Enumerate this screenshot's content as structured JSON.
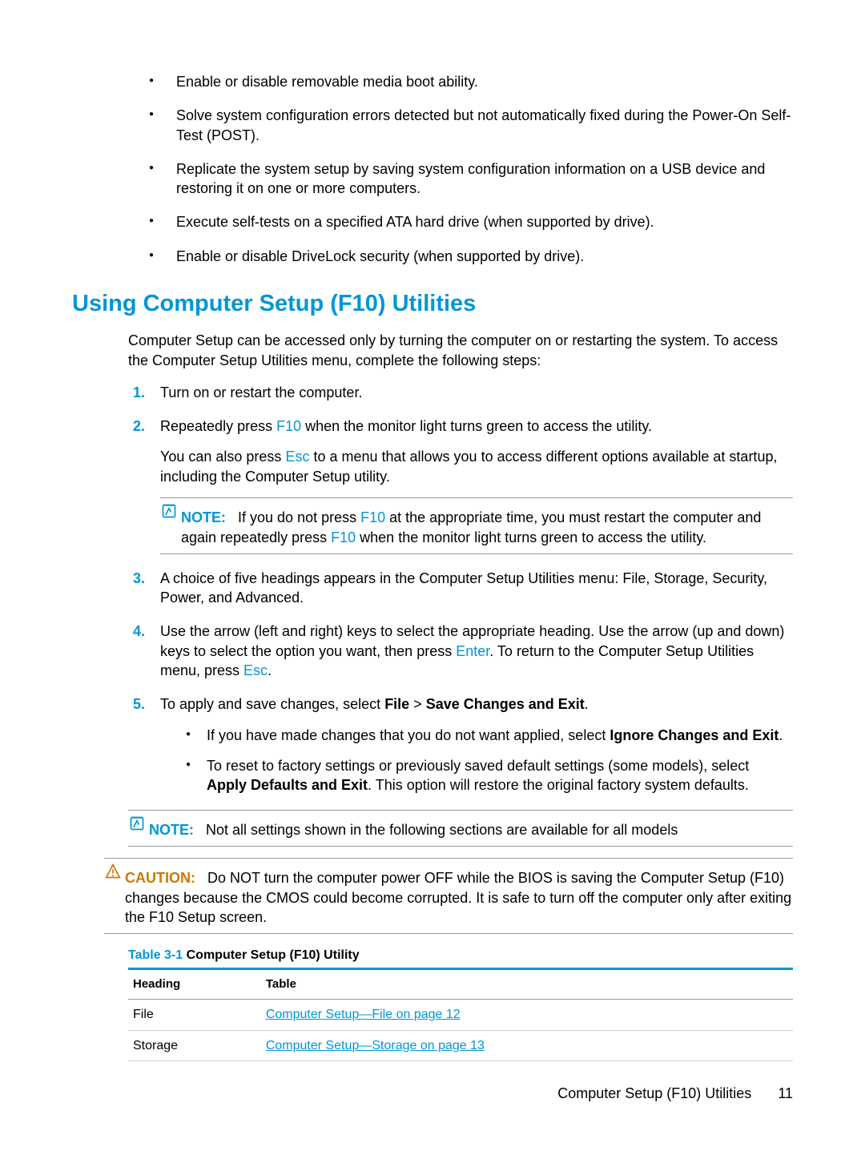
{
  "top_bullets": [
    "Enable or disable removable media boot ability.",
    "Solve system configuration errors detected but not automatically fixed during the Power-On Self-Test (POST).",
    "Replicate the system setup by saving system configuration information on a USB device and restoring it on one or more computers.",
    "Execute self-tests on a specified ATA hard drive (when supported by drive).",
    "Enable or disable DriveLock security (when supported by drive)."
  ],
  "section_title": "Using Computer Setup (F10) Utilities",
  "intro": "Computer Setup can be accessed only by turning the computer on or restarting the system. To access the Computer Setup Utilities menu, complete the following steps:",
  "keys": {
    "f10": "F10",
    "esc": "Esc",
    "enter": "Enter"
  },
  "steps": {
    "s1": "Turn on or restart the computer.",
    "s2_a": "Repeatedly press ",
    "s2_b": " when the monitor light turns green to access the utility.",
    "s2_c": "You can also press ",
    "s2_d": " to a menu that allows you to access different options available at startup, including the Computer Setup utility.",
    "note1_label": "NOTE:",
    "note1_a": "If you do not press ",
    "note1_b": " at the appropriate time, you must restart the computer and again repeatedly press ",
    "note1_c": " when the monitor light turns green to access the utility.",
    "s3": "A choice of five headings appears in the Computer Setup Utilities menu: File, Storage, Security, Power, and Advanced.",
    "s4_a": "Use the arrow (left and right) keys to select the appropriate heading. Use the arrow (up and down) keys to select the option you want, then press ",
    "s4_b": ". To return to the Computer Setup Utilities menu, press ",
    "s4_c": ".",
    "s5_a": "To apply and save changes, select ",
    "s5_file": "File",
    "s5_gt": " > ",
    "s5_save": "Save Changes and Exit",
    "s5_dot": ".",
    "sub1_a": "If you have made changes that you do not want applied, select ",
    "sub1_b": "Ignore Changes and Exit",
    "sub1_c": ".",
    "sub2_a": "To reset to factory settings or previously saved default settings (some models), select ",
    "sub2_b": "Apply Defaults and Exit",
    "sub2_c": ". This option will restore the original factory system defaults."
  },
  "note2_label": "NOTE:",
  "note2_text": "Not all settings shown in the following sections are available for all models",
  "caution_label": "CAUTION:",
  "caution_text": "Do NOT turn the computer power OFF while the BIOS is saving the Computer Setup (F10) changes because the CMOS could become corrupted. It is safe to turn off the computer only after exiting the F10 Setup screen.",
  "table_caption_num": "Table 3-1",
  "table_caption_title": "  Computer Setup (F10) Utility",
  "table": {
    "h1": "Heading",
    "h2": "Table",
    "rows": [
      {
        "heading": "File",
        "link": "Computer Setup—File on page 12"
      },
      {
        "heading": "Storage",
        "link": "Computer Setup—Storage on page 13"
      }
    ]
  },
  "footer_text": "Computer Setup (F10) Utilities",
  "page_number": "11"
}
